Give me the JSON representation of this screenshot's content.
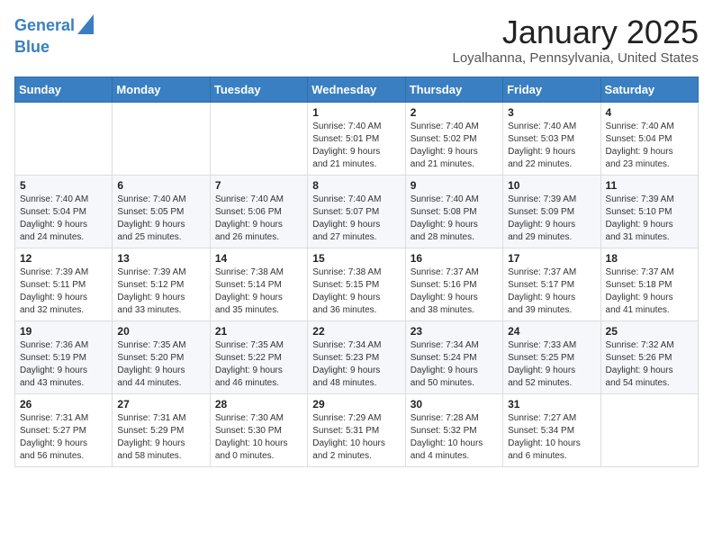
{
  "logo": {
    "line1": "General",
    "line2": "Blue"
  },
  "header": {
    "title": "January 2025",
    "subtitle": "Loyalhanna, Pennsylvania, United States"
  },
  "weekdays": [
    "Sunday",
    "Monday",
    "Tuesday",
    "Wednesday",
    "Thursday",
    "Friday",
    "Saturday"
  ],
  "weeks": [
    [
      {
        "day": "",
        "info": ""
      },
      {
        "day": "",
        "info": ""
      },
      {
        "day": "",
        "info": ""
      },
      {
        "day": "1",
        "info": "Sunrise: 7:40 AM\nSunset: 5:01 PM\nDaylight: 9 hours\nand 21 minutes."
      },
      {
        "day": "2",
        "info": "Sunrise: 7:40 AM\nSunset: 5:02 PM\nDaylight: 9 hours\nand 21 minutes."
      },
      {
        "day": "3",
        "info": "Sunrise: 7:40 AM\nSunset: 5:03 PM\nDaylight: 9 hours\nand 22 minutes."
      },
      {
        "day": "4",
        "info": "Sunrise: 7:40 AM\nSunset: 5:04 PM\nDaylight: 9 hours\nand 23 minutes."
      }
    ],
    [
      {
        "day": "5",
        "info": "Sunrise: 7:40 AM\nSunset: 5:04 PM\nDaylight: 9 hours\nand 24 minutes."
      },
      {
        "day": "6",
        "info": "Sunrise: 7:40 AM\nSunset: 5:05 PM\nDaylight: 9 hours\nand 25 minutes."
      },
      {
        "day": "7",
        "info": "Sunrise: 7:40 AM\nSunset: 5:06 PM\nDaylight: 9 hours\nand 26 minutes."
      },
      {
        "day": "8",
        "info": "Sunrise: 7:40 AM\nSunset: 5:07 PM\nDaylight: 9 hours\nand 27 minutes."
      },
      {
        "day": "9",
        "info": "Sunrise: 7:40 AM\nSunset: 5:08 PM\nDaylight: 9 hours\nand 28 minutes."
      },
      {
        "day": "10",
        "info": "Sunrise: 7:39 AM\nSunset: 5:09 PM\nDaylight: 9 hours\nand 29 minutes."
      },
      {
        "day": "11",
        "info": "Sunrise: 7:39 AM\nSunset: 5:10 PM\nDaylight: 9 hours\nand 31 minutes."
      }
    ],
    [
      {
        "day": "12",
        "info": "Sunrise: 7:39 AM\nSunset: 5:11 PM\nDaylight: 9 hours\nand 32 minutes."
      },
      {
        "day": "13",
        "info": "Sunrise: 7:39 AM\nSunset: 5:12 PM\nDaylight: 9 hours\nand 33 minutes."
      },
      {
        "day": "14",
        "info": "Sunrise: 7:38 AM\nSunset: 5:14 PM\nDaylight: 9 hours\nand 35 minutes."
      },
      {
        "day": "15",
        "info": "Sunrise: 7:38 AM\nSunset: 5:15 PM\nDaylight: 9 hours\nand 36 minutes."
      },
      {
        "day": "16",
        "info": "Sunrise: 7:37 AM\nSunset: 5:16 PM\nDaylight: 9 hours\nand 38 minutes."
      },
      {
        "day": "17",
        "info": "Sunrise: 7:37 AM\nSunset: 5:17 PM\nDaylight: 9 hours\nand 39 minutes."
      },
      {
        "day": "18",
        "info": "Sunrise: 7:37 AM\nSunset: 5:18 PM\nDaylight: 9 hours\nand 41 minutes."
      }
    ],
    [
      {
        "day": "19",
        "info": "Sunrise: 7:36 AM\nSunset: 5:19 PM\nDaylight: 9 hours\nand 43 minutes."
      },
      {
        "day": "20",
        "info": "Sunrise: 7:35 AM\nSunset: 5:20 PM\nDaylight: 9 hours\nand 44 minutes."
      },
      {
        "day": "21",
        "info": "Sunrise: 7:35 AM\nSunset: 5:22 PM\nDaylight: 9 hours\nand 46 minutes."
      },
      {
        "day": "22",
        "info": "Sunrise: 7:34 AM\nSunset: 5:23 PM\nDaylight: 9 hours\nand 48 minutes."
      },
      {
        "day": "23",
        "info": "Sunrise: 7:34 AM\nSunset: 5:24 PM\nDaylight: 9 hours\nand 50 minutes."
      },
      {
        "day": "24",
        "info": "Sunrise: 7:33 AM\nSunset: 5:25 PM\nDaylight: 9 hours\nand 52 minutes."
      },
      {
        "day": "25",
        "info": "Sunrise: 7:32 AM\nSunset: 5:26 PM\nDaylight: 9 hours\nand 54 minutes."
      }
    ],
    [
      {
        "day": "26",
        "info": "Sunrise: 7:31 AM\nSunset: 5:27 PM\nDaylight: 9 hours\nand 56 minutes."
      },
      {
        "day": "27",
        "info": "Sunrise: 7:31 AM\nSunset: 5:29 PM\nDaylight: 9 hours\nand 58 minutes."
      },
      {
        "day": "28",
        "info": "Sunrise: 7:30 AM\nSunset: 5:30 PM\nDaylight: 10 hours\nand 0 minutes."
      },
      {
        "day": "29",
        "info": "Sunrise: 7:29 AM\nSunset: 5:31 PM\nDaylight: 10 hours\nand 2 minutes."
      },
      {
        "day": "30",
        "info": "Sunrise: 7:28 AM\nSunset: 5:32 PM\nDaylight: 10 hours\nand 4 minutes."
      },
      {
        "day": "31",
        "info": "Sunrise: 7:27 AM\nSunset: 5:34 PM\nDaylight: 10 hours\nand 6 minutes."
      },
      {
        "day": "",
        "info": ""
      }
    ]
  ]
}
